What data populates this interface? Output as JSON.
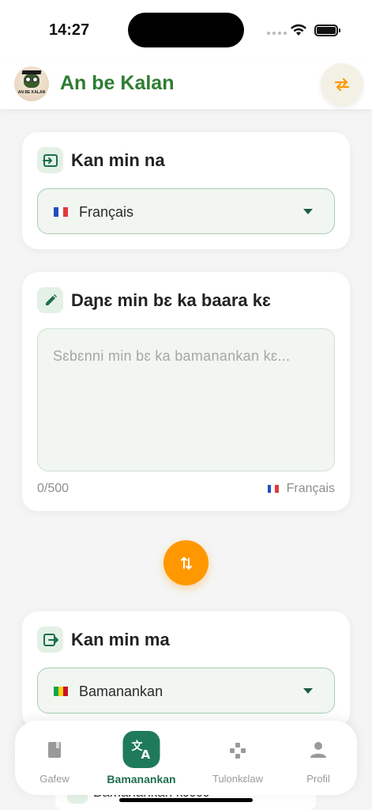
{
  "status_bar": {
    "time": "14:27"
  },
  "header": {
    "app_title": "An be Kalan",
    "logo_text": "AN BE KALAN"
  },
  "source_card": {
    "title": "Kan min na",
    "selected_language": "Français",
    "flag_colors": [
      "#1f4fbf",
      "#ffffff",
      "#e03a3e"
    ]
  },
  "input_card": {
    "title": "Daɲɛ min bɛ ka baara kɛ",
    "placeholder": "Sɛbɛnni min bɛ ka bamanankan kɛ...",
    "char_count": "0/500",
    "language": "Français"
  },
  "target_card": {
    "title": "Kan min ma",
    "selected_language": "Bamanankan",
    "flag_colors": [
      "#14a64a",
      "#fcd116",
      "#ce1126"
    ]
  },
  "peek": {
    "label": "Bamanankan kɔɔɔɔ"
  },
  "bottom_nav": {
    "items": [
      {
        "label": "Gafew",
        "icon": "book-icon"
      },
      {
        "label": "Bamanankan",
        "icon": "translate-icon",
        "active": true
      },
      {
        "label": "Tulonkɛlaw",
        "icon": "gamepad-icon"
      },
      {
        "label": "Profil",
        "icon": "person-icon"
      }
    ]
  },
  "colors": {
    "brand_green": "#2e7d32",
    "accent_orange": "#ff9800",
    "nav_active": "#1f7a5c"
  }
}
